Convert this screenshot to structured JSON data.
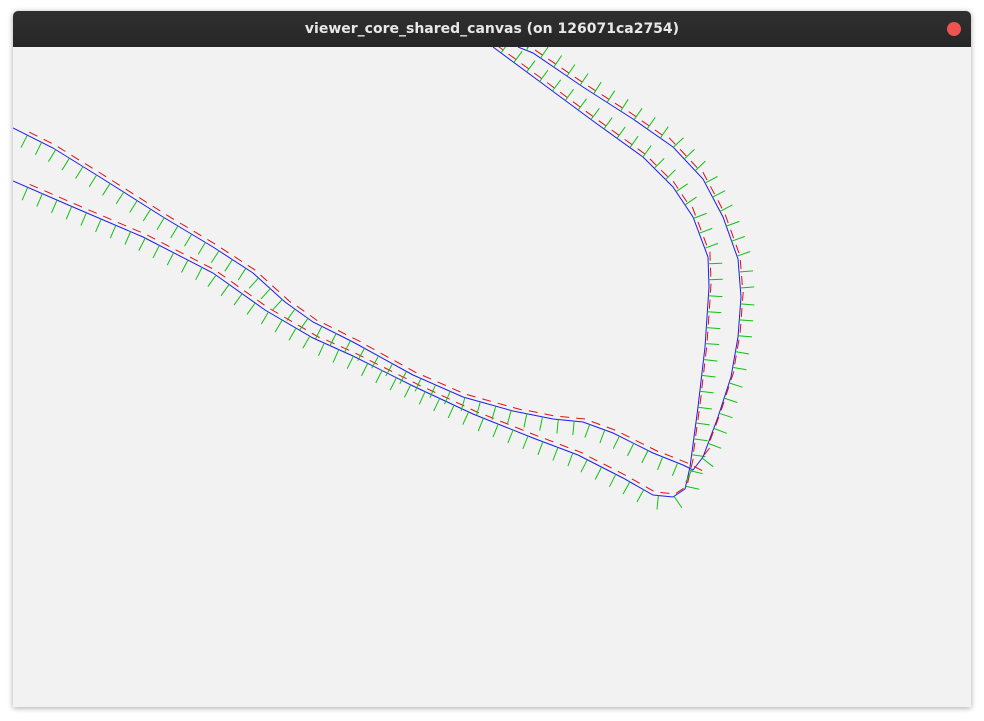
{
  "window": {
    "title": "viewer_core_shared_canvas (on 126071ca2754)"
  },
  "colors": {
    "titlebar": "#2b2b2b",
    "title_text": "#e8e8e8",
    "close_button": "#ef5350",
    "canvas_background": "#f2f2f2",
    "path_line": "#1c1cf0",
    "heading_tick": "#e01010",
    "normal_tick": "#10c010"
  },
  "icons": {
    "close": "close-icon"
  }
}
